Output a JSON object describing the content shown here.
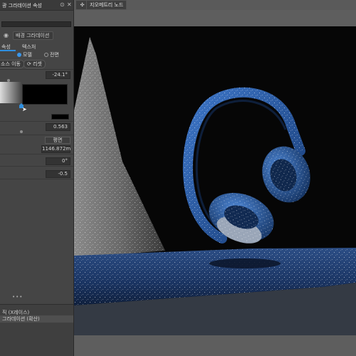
{
  "panel": {
    "title": "광 그라데이션 속성",
    "material_slot": "배경 그라데이션",
    "tabs": [
      {
        "label": "속성"
      },
      {
        "label": "텍스처"
      }
    ],
    "radio": [
      {
        "label": "모델",
        "selected": true
      },
      {
        "label": "전면",
        "selected": false
      }
    ],
    "buttons": [
      {
        "label": "소스 이동"
      },
      {
        "label": "리셋"
      }
    ],
    "fields": {
      "angle": "-24.1°",
      "value_a": "0.563",
      "dropdown": "평면",
      "distance": "1146.872m",
      "rotation": "0°",
      "offset": "-0.5"
    },
    "dots": "•••",
    "bottom_items": [
      {
        "label": "직 (X레이스)",
        "active": false
      },
      {
        "label": "그라데이션 (확산)",
        "active": true
      }
    ]
  },
  "viewport": {
    "toolbar_button": "지오메트리 노드"
  },
  "colors": {
    "accent": "#2f8fe0",
    "headphone_blue": "#1f4f95",
    "panel_bg": "#454545"
  },
  "icons": [
    "material-icon",
    "close-icon",
    "pin-icon",
    "move-icon",
    "reset-icon",
    "cursor-icon"
  ]
}
